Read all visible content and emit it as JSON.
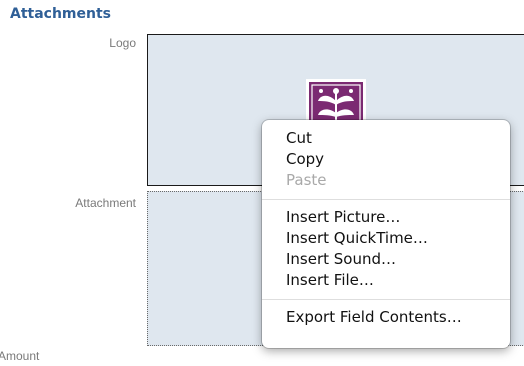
{
  "section": {
    "title": "Attachments"
  },
  "fields": {
    "logo_label": "Logo",
    "attachment_label": "Attachment",
    "amount_label": "Amount"
  },
  "colors": {
    "section_title": "#2f5f97",
    "field_background": "#dfe7ef",
    "logo_purple": "#7b2a72"
  },
  "context_menu": {
    "group1": [
      {
        "label": "Cut",
        "enabled": true
      },
      {
        "label": "Copy",
        "enabled": true
      },
      {
        "label": "Paste",
        "enabled": false
      }
    ],
    "group2": [
      {
        "label": "Insert Picture…",
        "enabled": true
      },
      {
        "label": "Insert QuickTime…",
        "enabled": true
      },
      {
        "label": "Insert Sound…",
        "enabled": true
      },
      {
        "label": "Insert File…",
        "enabled": true
      }
    ],
    "group3": [
      {
        "label": "Export Field Contents…",
        "enabled": true
      }
    ]
  },
  "icons": {
    "logo": "ornamental-leaf-logo-icon"
  }
}
